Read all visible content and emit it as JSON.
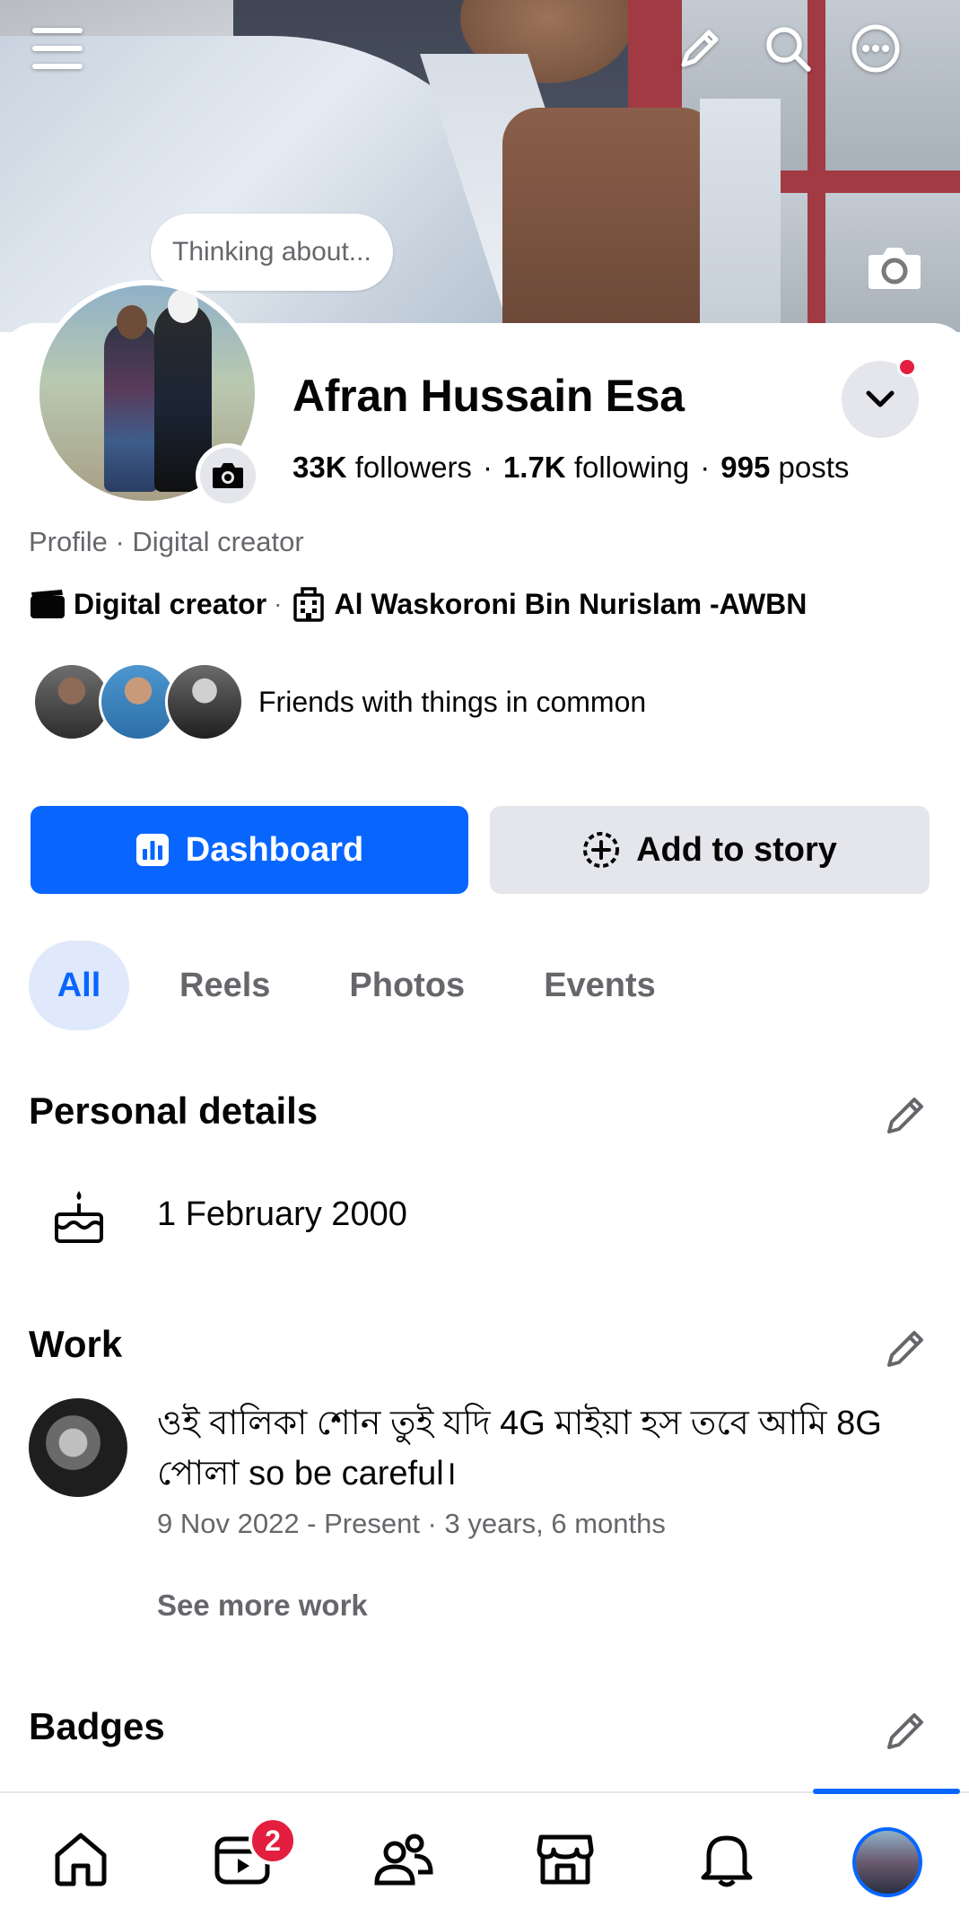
{
  "cover": {
    "thought_bubble": "Thinking about..."
  },
  "profile": {
    "name": "Afran Hussain Esa",
    "followers_count": "33K",
    "followers_label": "followers",
    "following_count": "1.7K",
    "following_label": "following",
    "posts_count": "995",
    "posts_label": "posts",
    "stats_separator": "·",
    "profile_type": "Profile · Digital creator",
    "category": "Digital creator",
    "meta_separator": "·",
    "workplace": "Al Waskoroni Bin Nurislam -AWBN",
    "friends_text": "Friends with things in common"
  },
  "actions": {
    "dashboard_label": "Dashboard",
    "add_story_label": "Add to story"
  },
  "tabs": [
    {
      "label": "All",
      "active": true
    },
    {
      "label": "Reels",
      "active": false
    },
    {
      "label": "Photos",
      "active": false
    },
    {
      "label": "Events",
      "active": false
    }
  ],
  "personal_details": {
    "title": "Personal details",
    "birthday": "1 February 2000"
  },
  "work": {
    "title": "Work",
    "item_title": "ওই বালিকা শোন তুই যদি 4G মাইয়া হস তবে আমি 8G পোলা  so be careful।",
    "item_dates": "9 Nov 2022 - Present · 3 years, 6 months",
    "see_more": "See more work"
  },
  "badges": {
    "title": "Badges"
  },
  "bottom_nav": {
    "video_badge": "2",
    "active_item": "profile"
  },
  "colors": {
    "accent": "#0866ff",
    "notification_red": "#e41e3f",
    "secondary_text": "#65676b",
    "button_gray": "#e4e6eb"
  }
}
